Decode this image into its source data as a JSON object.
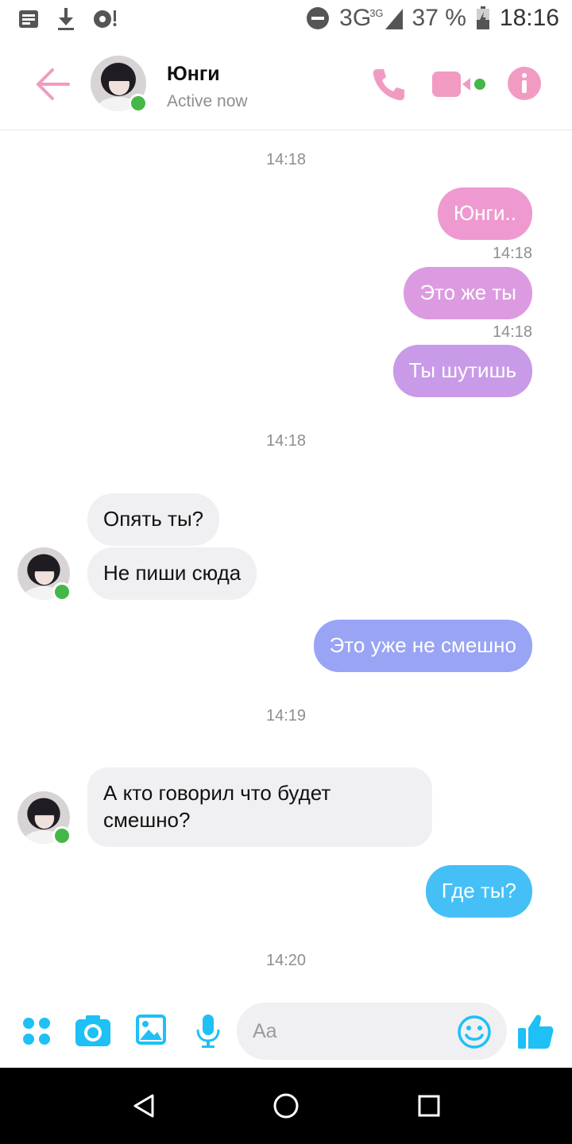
{
  "status_bar": {
    "network": "3G",
    "network_small": "3G",
    "battery": "37 %",
    "time": "18:16"
  },
  "header": {
    "contact_name": "Юнги",
    "contact_status": "Active now"
  },
  "colors": {
    "accent_pink": "#f29bc2",
    "online": "#44b748",
    "messenger_blue": "#1ec0f5"
  },
  "messages": [
    {
      "type": "timestamp",
      "text": "14:18"
    },
    {
      "type": "out",
      "text": "Юнги.."
    },
    {
      "type": "time",
      "text": "14:18"
    },
    {
      "type": "out",
      "text": "Это же ты"
    },
    {
      "type": "time",
      "text": "14:18"
    },
    {
      "type": "out",
      "text": "Ты шутишь"
    },
    {
      "type": "timestamp",
      "text": "14:18"
    },
    {
      "type": "in",
      "text": "Опять ты?"
    },
    {
      "type": "in",
      "text": "Не пиши сюда"
    },
    {
      "type": "out",
      "text": "Это уже не смешно"
    },
    {
      "type": "timestamp",
      "text": "14:19"
    },
    {
      "type": "in",
      "text": "А кто говорил что будет\nсмешно?"
    },
    {
      "type": "out",
      "text": "Где ты?"
    },
    {
      "type": "timestamp",
      "text": "14:20"
    }
  ],
  "composer": {
    "placeholder": "Aa",
    "icons": [
      "apps-icon",
      "camera-icon",
      "gallery-icon",
      "microphone-icon",
      "emoji-icon",
      "thumbs-up-icon"
    ]
  }
}
